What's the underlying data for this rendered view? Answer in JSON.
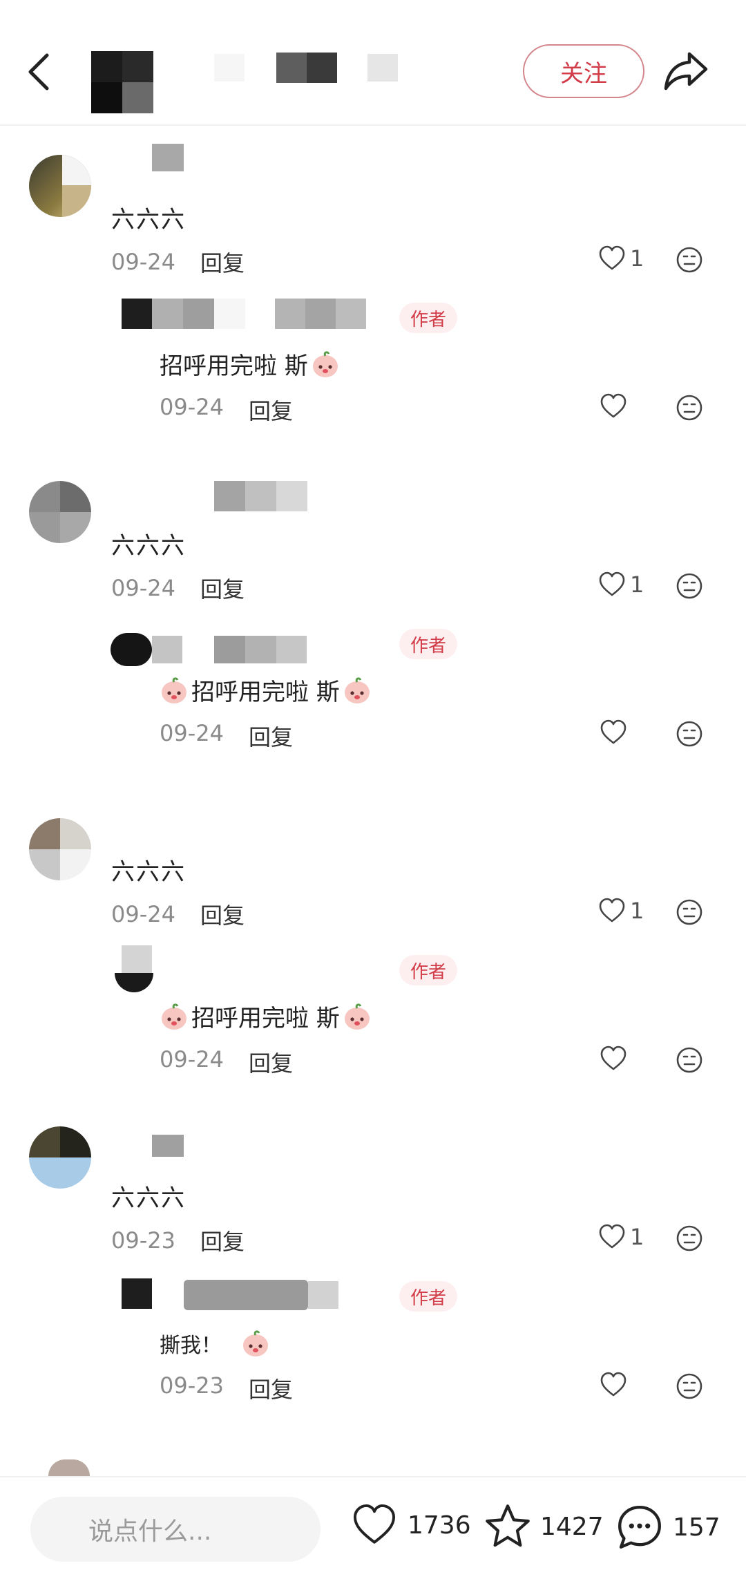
{
  "header": {
    "follow_label": "关注",
    "icons": {
      "back": "back-arrow-icon",
      "share": "share-icon"
    }
  },
  "comments": [
    {
      "text": "六六六",
      "date": "09-24",
      "reply_label": "回复",
      "likes": "1",
      "reply": {
        "author_tag": "作者",
        "text": "招呼用完啦 斯",
        "date": "09-24",
        "reply_label": "回复"
      }
    },
    {
      "text": "六六六",
      "date": "09-24",
      "reply_label": "回复",
      "likes": "1",
      "reply": {
        "author_tag": "作者",
        "text": "招呼用完啦 斯",
        "date": "09-24",
        "reply_label": "回复"
      }
    },
    {
      "text": "六六六",
      "date": "09-24",
      "reply_label": "回复",
      "likes": "1",
      "reply": {
        "author_tag": "作者",
        "text": "招呼用完啦 斯",
        "date": "09-24",
        "reply_label": "回复"
      }
    },
    {
      "text": "六六六",
      "date": "09-23",
      "reply_label": "回复",
      "likes": "1",
      "reply": {
        "author_tag": "作者",
        "text": "撕我！",
        "date": "09-23",
        "reply_label": "回复"
      }
    }
  ],
  "bottom_bar": {
    "input_placeholder": "说点什么...",
    "likes": "1736",
    "favorites": "1427",
    "comments": "157"
  },
  "colors": {
    "accent": "#d23c48",
    "tag_bg": "#fdeef0",
    "muted": "#8a8a8a"
  }
}
